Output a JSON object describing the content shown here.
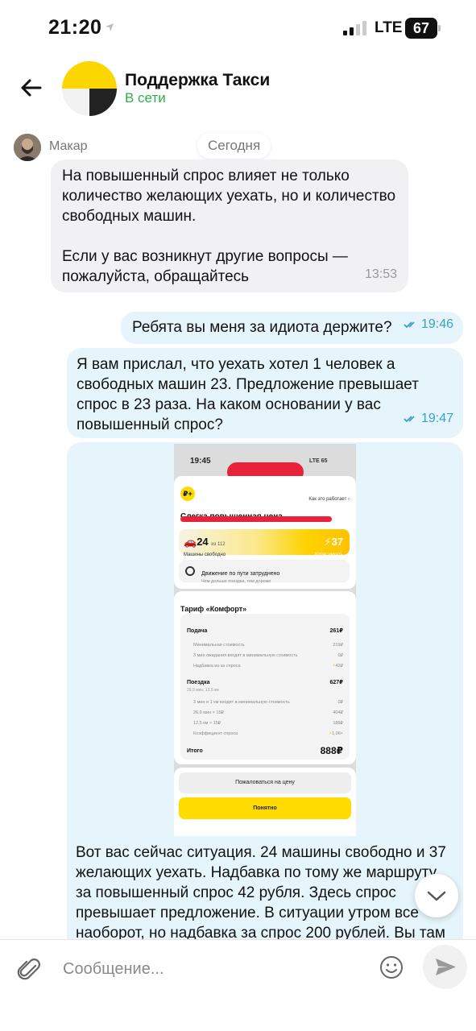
{
  "status_bar": {
    "time": "21:20",
    "network": "LTE",
    "battery": "67"
  },
  "header": {
    "title": "Поддержка Такси",
    "status": "В сети",
    "status_color": "#2fae4a"
  },
  "chat": {
    "date_chip": "Сегодня",
    "sender_name": "Макар",
    "messages": [
      {
        "direction": "in",
        "text": "На повышенный спрос влияет не только количество желающих уехать, но и количество свободных машин.\n\nЕсли у вас возникнут другие вопросы — пожалуйста, обращайтесь",
        "time": "13:53"
      },
      {
        "direction": "out",
        "text": "Ребята вы меня за идиота держите?",
        "time": "19:46"
      },
      {
        "direction": "out",
        "text": "Я вам прислал, что уехать хотел 1 человек а свободных машин 23. Предложение превышает спрос в 23 раза. На каком основании у вас повышенный спрос?",
        "time": "19:47"
      },
      {
        "direction": "out",
        "text": "Вот вас сейчас ситуация. 24 машины свободно и 37 желающих уехать. Надбавка по тому же маршруту за повышенный спрос 42 рубля. Здесь спрос превышает предложение. В ситуации утром все наоборот, но надбавка за спрос 200 рублей. Вы там",
        "attachment": {
          "time": "19:45",
          "network": "LTE",
          "battery": "65",
          "badge": "₽+",
          "how_link": "Как это работает",
          "heading": "Слегка повышенная цена",
          "free_cars": "24",
          "free_cars_of": "из 112",
          "free_cars_label": "Машины свободно",
          "want": "37",
          "want_label": "Хотят уехать",
          "traffic_title": "Движение по пути затруднено",
          "traffic_sub": "Чем дольше поездка, тем дороже",
          "tariff": "Тариф «Комфорт»",
          "rows": [
            {
              "label": "Подача",
              "value": "261₽",
              "kind": "main"
            },
            {
              "label": "Минимальная стоимость",
              "value": "219₽",
              "kind": "sub"
            },
            {
              "label": "3 мин ожидания входят в минимальную стоимость",
              "value": "0₽",
              "kind": "sub"
            },
            {
              "label": "Надбавка из-за спроса",
              "value": "42₽",
              "kind": "sub",
              "bolt": true
            },
            {
              "label": "Поездка",
              "value": "627₽",
              "kind": "main"
            },
            {
              "label": "29,9 мин, 13,5 км",
              "value": "",
              "kind": "sub2"
            },
            {
              "label": "3 мин и 1 км входят в минимальную стоимость",
              "value": "0₽",
              "kind": "sub"
            },
            {
              "label": "26,9 мин × 15₽",
              "value": "404₽",
              "kind": "sub"
            },
            {
              "label": "12,5 км × 15₽",
              "value": "188₽",
              "kind": "sub"
            },
            {
              "label": "Коэффициент спроса",
              "value": "1,06×",
              "kind": "sub",
              "bolt": true
            },
            {
              "label": "Итого",
              "value": "888₽",
              "kind": "total"
            }
          ],
          "complain_button": "Пожаловаться на цену",
          "ok_button": "Понятно"
        }
      }
    ]
  },
  "composer": {
    "placeholder": "Сообщение..."
  },
  "icons": {
    "back": "arrow-left-icon",
    "attach": "paperclip-icon",
    "emoji": "smile-icon",
    "send": "send-icon",
    "scroll": "chevron-down-icon",
    "read": "double-check-icon"
  },
  "colors": {
    "outgoing_bubble": "#e6f5fb",
    "incoming_bubble": "#f1f1f3",
    "accent": "#ffdb00",
    "check": "#3a9fca"
  }
}
